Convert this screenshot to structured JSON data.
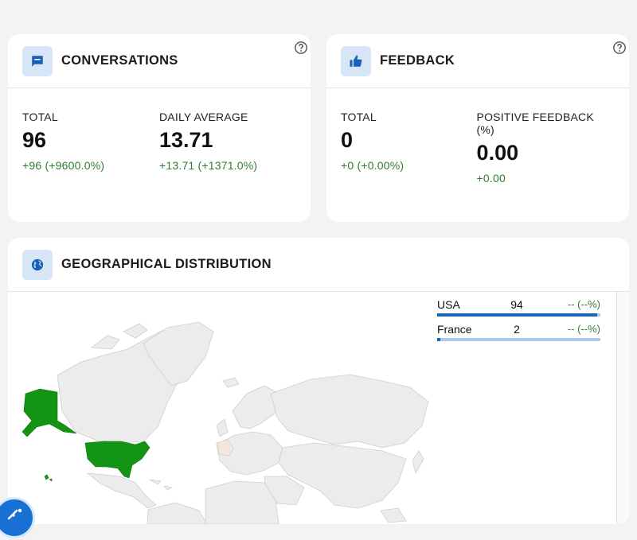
{
  "conversations": {
    "title": "CONVERSATIONS",
    "icon": "chat-icon",
    "stats": [
      {
        "label": "TOTAL",
        "value": "96",
        "delta": "+96 (+9600.0%)"
      },
      {
        "label": "DAILY AVERAGE",
        "value": "13.71",
        "delta": "+13.71 (+1371.0%)"
      }
    ]
  },
  "feedback": {
    "title": "FEEDBACK",
    "icon": "thumbs-up-icon",
    "stats": [
      {
        "label": "TOTAL",
        "value": "0",
        "delta": "+0 (+0.00%)"
      },
      {
        "label": "POSITIVE FEEDBACK (%)",
        "value": "0.00",
        "delta": "+0.00"
      }
    ]
  },
  "geo": {
    "title": "GEOGRAPHICAL DISTRIBUTION",
    "icon": "globe-icon",
    "countries": [
      {
        "name": "USA",
        "count": "94",
        "change": "-- (--%)",
        "share": 0.98
      },
      {
        "name": "France",
        "count": "2",
        "change": "-- (--%)",
        "share": 0.02
      }
    ]
  },
  "colors": {
    "accent": "#1866b8",
    "positive": "#2f7d32",
    "icon_bg": "#d6e6f7",
    "map_highlight": "#149414",
    "map_land": "#ececec"
  }
}
